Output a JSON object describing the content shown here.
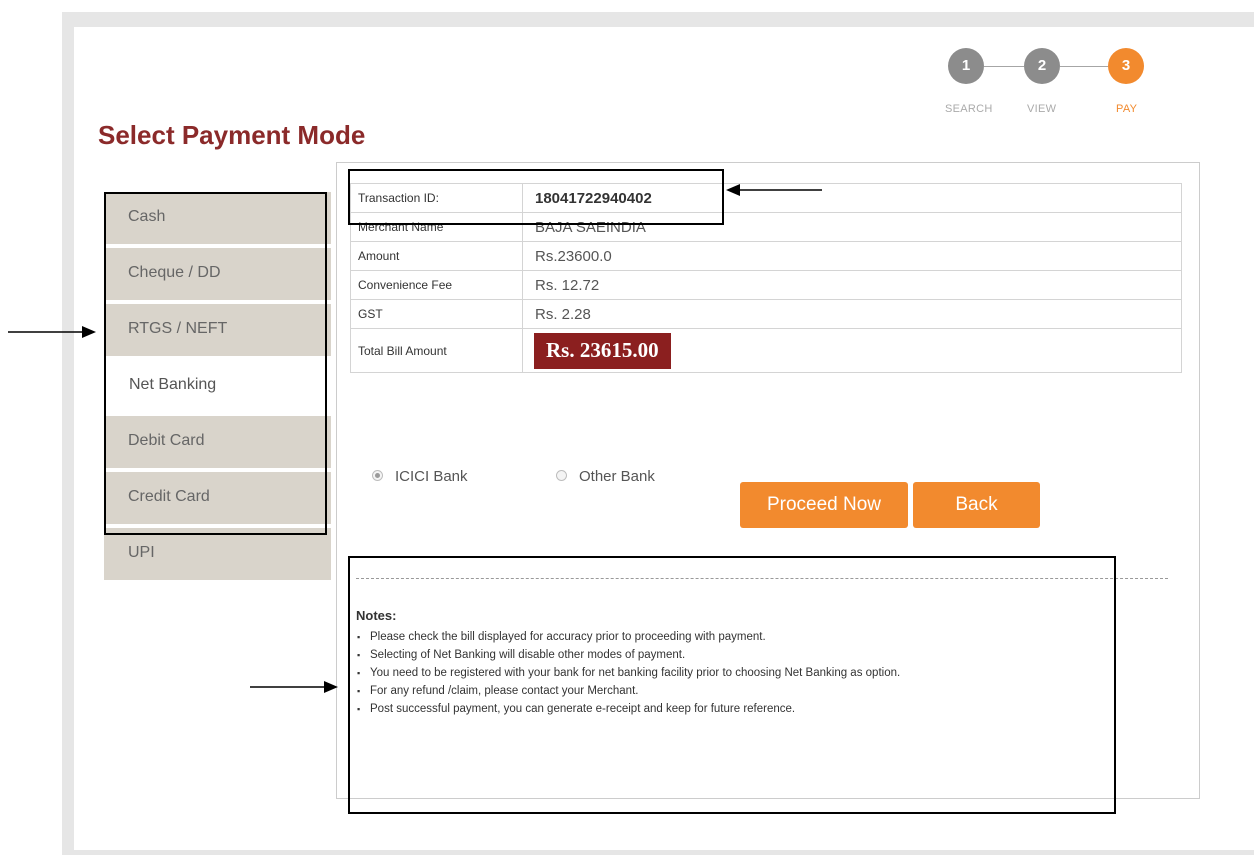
{
  "stepper": {
    "steps": [
      {
        "number": "1",
        "label": "SEARCH",
        "state": "done"
      },
      {
        "number": "2",
        "label": "VIEW",
        "state": "done"
      },
      {
        "number": "3",
        "label": "PAY",
        "state": "active"
      }
    ]
  },
  "page_title": "Select Payment Mode",
  "payment_modes": [
    {
      "label": "Cash",
      "active": false
    },
    {
      "label": "Cheque / DD",
      "active": false
    },
    {
      "label": "RTGS / NEFT",
      "active": false
    },
    {
      "label": "Net Banking",
      "active": true
    },
    {
      "label": "Debit Card",
      "active": false
    },
    {
      "label": "Credit Card",
      "active": false
    },
    {
      "label": "UPI",
      "active": false
    }
  ],
  "bill": {
    "rows": [
      {
        "key": "Transaction ID:",
        "value": "18041722940402"
      },
      {
        "key": "Merchant Name",
        "value": "BAJA SAEINDIA"
      },
      {
        "key": "Amount",
        "value": "Rs.23600.0"
      },
      {
        "key": "Convenience Fee",
        "value": "Rs. 12.72"
      },
      {
        "key": "GST",
        "value": "Rs. 2.28"
      },
      {
        "key": "Total Bill Amount",
        "value": "Rs. 23615.00"
      }
    ]
  },
  "bank_options": [
    {
      "label": "ICICI Bank",
      "selected": true
    },
    {
      "label": "Other Bank",
      "selected": false
    }
  ],
  "buttons": {
    "proceed": "Proceed Now",
    "back": "Back"
  },
  "notes": {
    "title": "Notes:",
    "items": [
      "Please check the bill displayed for accuracy prior to proceeding with payment.",
      "Selecting of Net Banking will disable other modes of payment.",
      "You need to be registered with your bank for net banking facility prior to choosing Net Banking as option.",
      "For any refund /claim, please contact your Merchant.",
      "Post successful payment, you can generate e-receipt and keep for future reference."
    ]
  },
  "colors": {
    "accent": "#f28a2e",
    "title": "#8b2a2a",
    "total_badge": "#8b1f1f",
    "tab_bg": "#d9d4cb",
    "step_done": "#8c8c8c"
  }
}
